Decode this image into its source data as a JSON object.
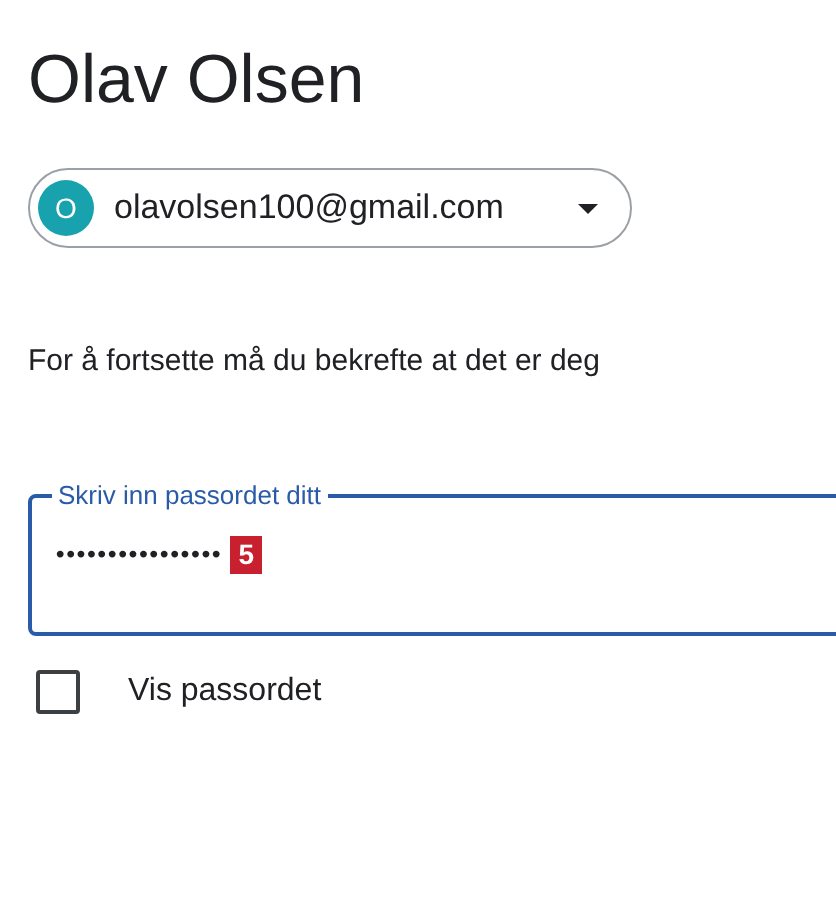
{
  "title": "Olav Olsen",
  "account": {
    "avatar_letter": "O",
    "email": "olavolsen100@gmail.com"
  },
  "prompt": "For å fortsette må du bekrefte at det er deg",
  "password_field": {
    "label": "Skriv inn passordet ditt",
    "value": "••••••••••••••••",
    "focused": true,
    "badge": "5"
  },
  "show_password": {
    "label": "Vis passordet",
    "checked": false
  }
}
